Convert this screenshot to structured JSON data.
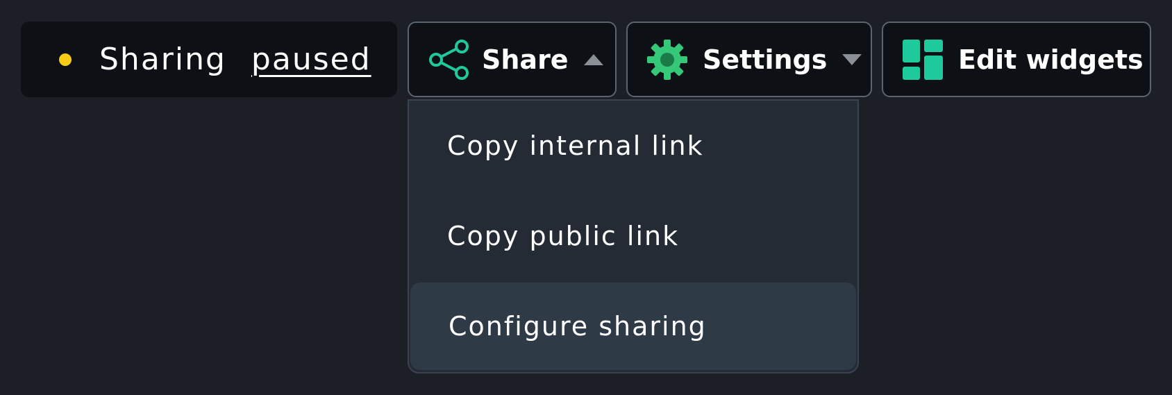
{
  "status": {
    "word": "Sharing",
    "link": "paused",
    "dot_color": "#f5cd16"
  },
  "toolbar": {
    "share": {
      "label": "Share",
      "icon": "share-icon",
      "caret": "up",
      "icon_color": "#1ec99b"
    },
    "settings": {
      "label": "Settings",
      "icon": "gear-icon",
      "caret": "down",
      "icon_color": "#35c878"
    },
    "edit_widgets": {
      "label": "Edit widgets",
      "icon": "widgets-layout-icon",
      "icon_color": "#1ec99b"
    }
  },
  "share_menu": {
    "open": true,
    "items": [
      {
        "label": "Copy internal link"
      },
      {
        "label": "Copy public link"
      },
      {
        "label": "Configure sharing",
        "highlighted": true
      }
    ]
  }
}
